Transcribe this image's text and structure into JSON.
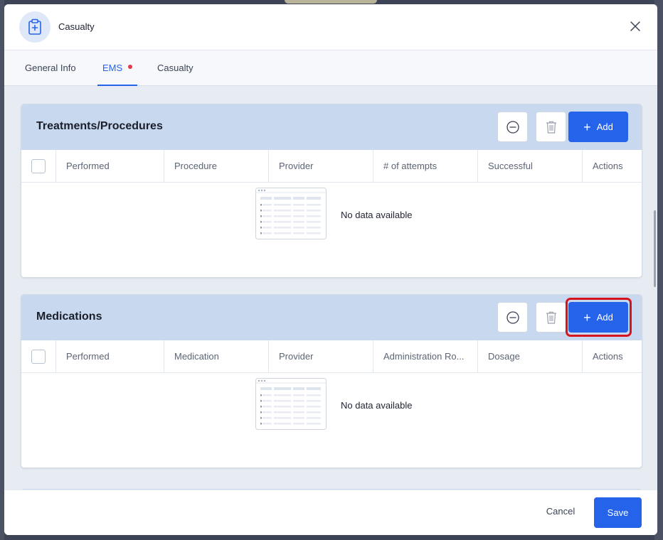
{
  "modal": {
    "title": "Casualty",
    "icon": "clipboard-medical-icon"
  },
  "tabs": [
    {
      "label": "General Info",
      "active": false,
      "dot": false
    },
    {
      "label": "EMS",
      "active": true,
      "dot": true
    },
    {
      "label": "Casualty",
      "active": false,
      "dot": false
    }
  ],
  "colors": {
    "accent": "#2563eb",
    "section_header": "#c8d8ee",
    "highlight": "#d6141d",
    "tab_dot": "#e23b4b"
  },
  "sections": [
    {
      "title": "Treatments/Procedures",
      "add_label": "Add",
      "columns": [
        "Performed",
        "Procedure",
        "Provider",
        "# of attempts",
        "Successful",
        "Actions"
      ],
      "empty_text": "No data available",
      "add_highlighted": false
    },
    {
      "title": "Medications",
      "add_label": "Add",
      "columns": [
        "Performed",
        "Medication",
        "Provider",
        "Administration Ro...",
        "Dosage",
        "Actions"
      ],
      "empty_text": "No data available",
      "add_highlighted": true
    }
  ],
  "footer": {
    "cancel_label": "Cancel",
    "save_label": "Save"
  }
}
